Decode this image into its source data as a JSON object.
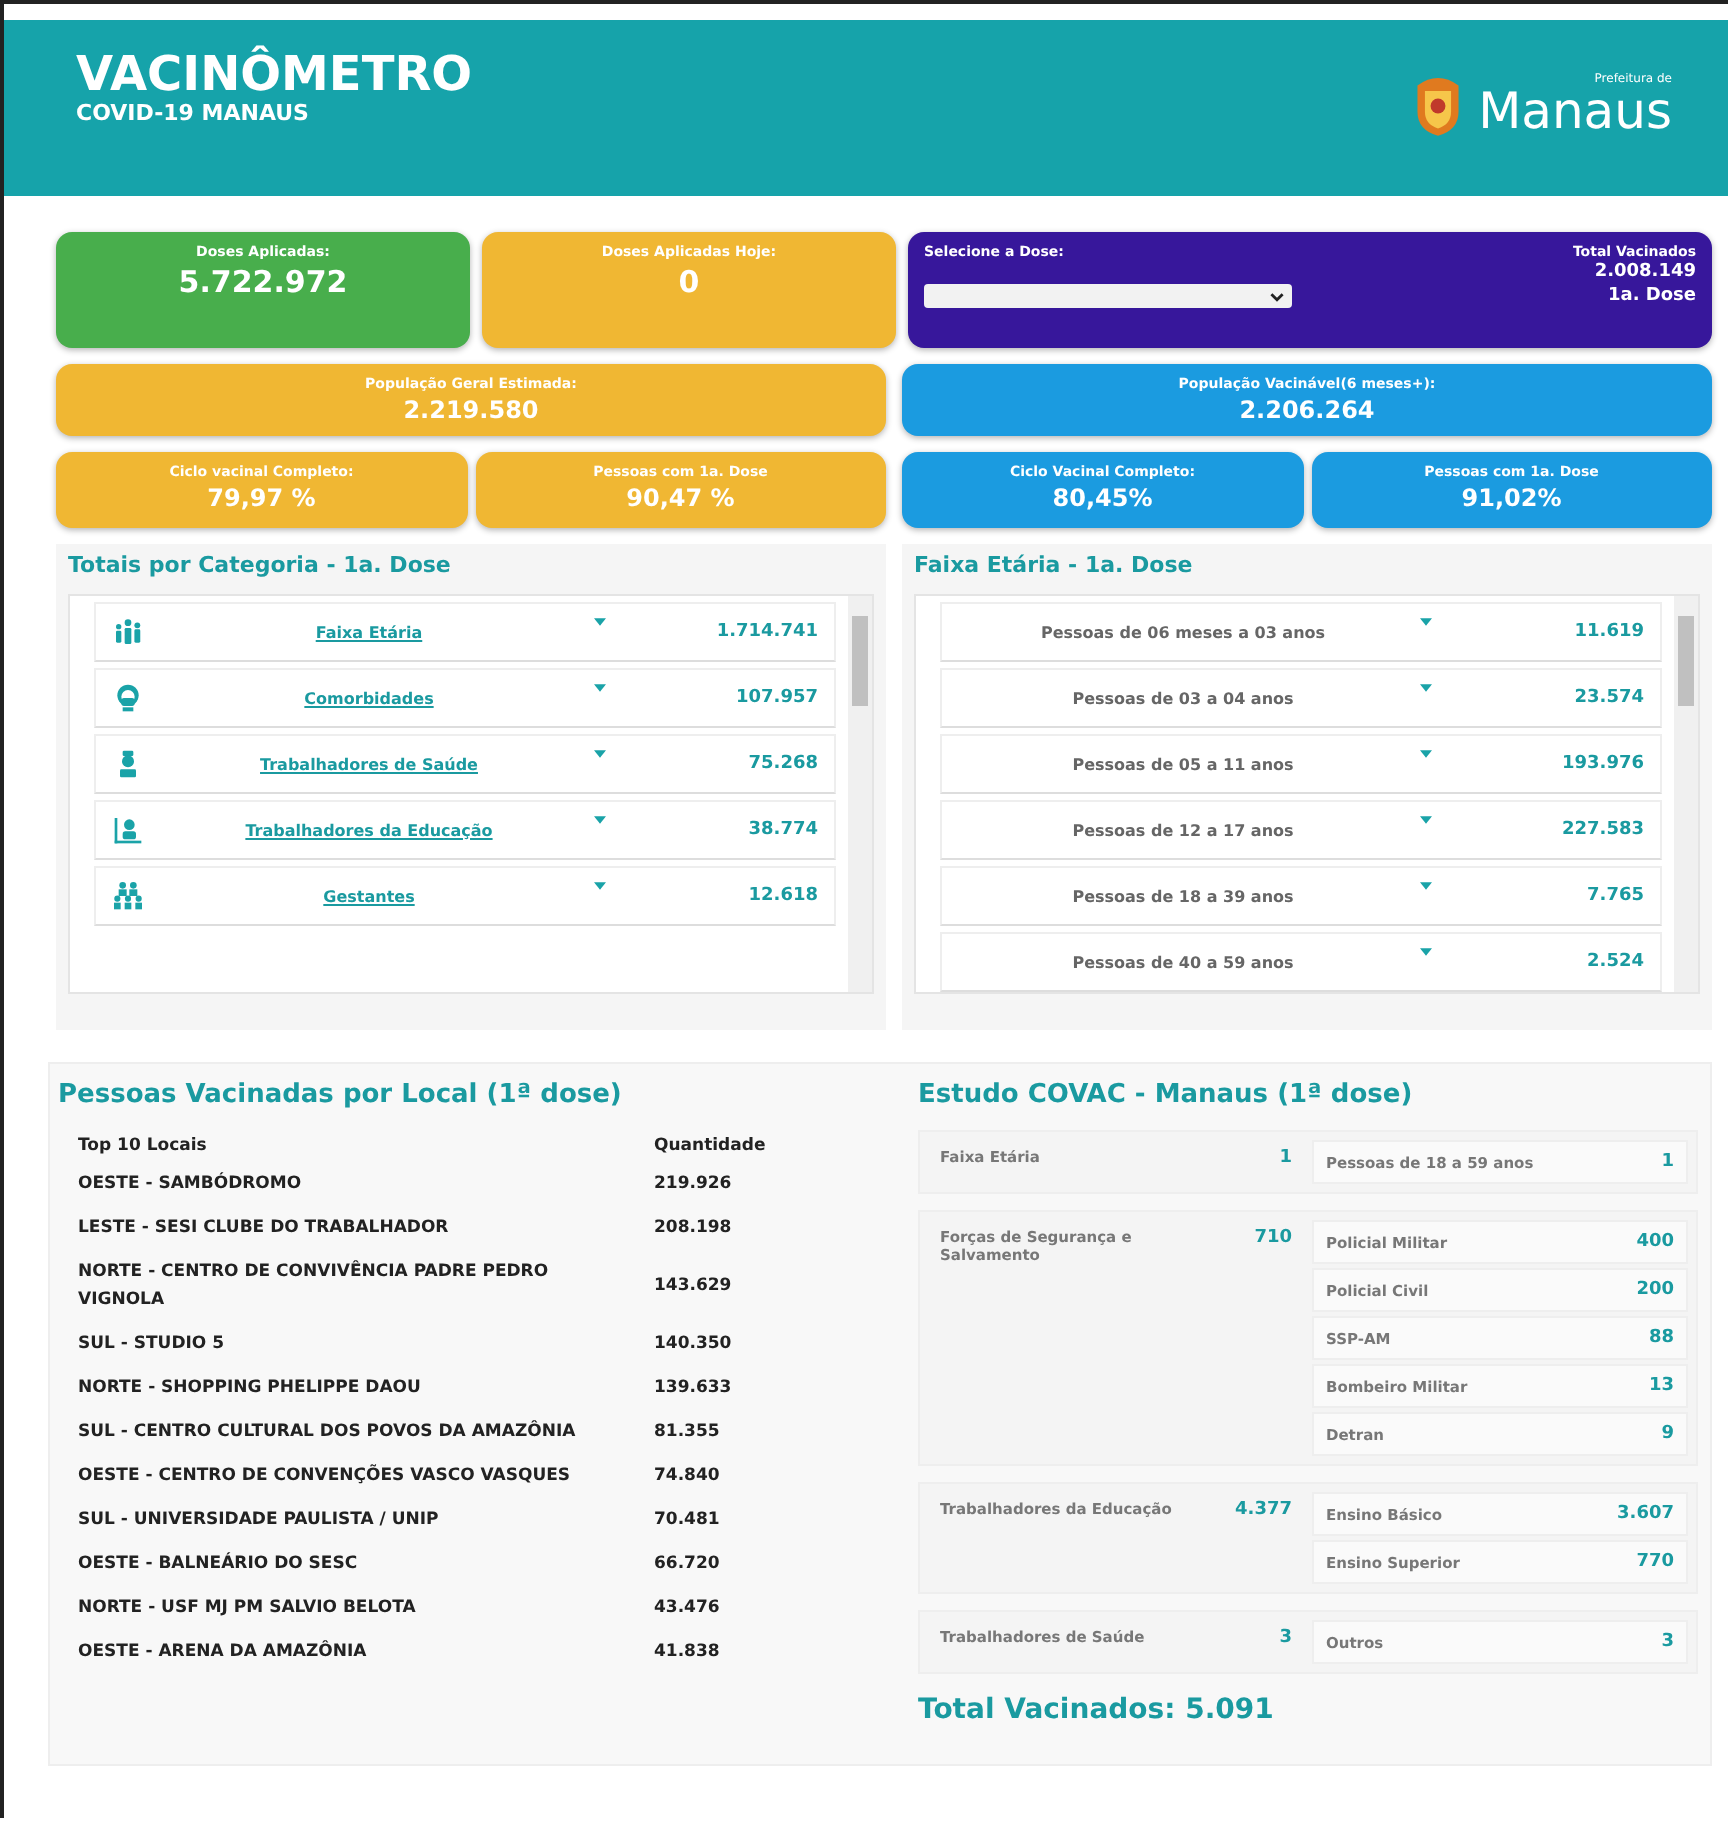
{
  "header": {
    "title": "VACINÔMETRO",
    "subtitle": "COVID-19 MANAUS",
    "logo_small": "Prefeitura de",
    "logo_name": "Manaus"
  },
  "doses_aplicadas": {
    "label": "Doses Aplicadas:",
    "value": "5.722.972"
  },
  "doses_hoje": {
    "label": "Doses Aplicadas Hoje:",
    "value": "0"
  },
  "dose_selector": {
    "label": "Selecione a Dose:",
    "total_label": "Total Vacinados",
    "total_value": "2.008.149",
    "dose": "1a. Dose"
  },
  "populacao_geral": {
    "label": "População Geral Estimada:",
    "value": "2.219.580"
  },
  "populacao_vacinavel": {
    "label": "População Vacinável(6 meses+):",
    "value": "2.206.264"
  },
  "geral_stats": [
    {
      "label": "Ciclo vacinal Completo:",
      "value": "79,97 %"
    },
    {
      "label": "Pessoas com 1a. Dose",
      "value": "90,47 %"
    }
  ],
  "vacinavel_stats": [
    {
      "label": "Ciclo Vacinal Completo:",
      "value": "80,45%"
    },
    {
      "label": "Pessoas com 1a. Dose",
      "value": "91,02%"
    }
  ],
  "categorias": {
    "title": "Totais por Categoria - 1a. Dose",
    "items": [
      {
        "label": "Faixa Etária",
        "value": "1.714.741"
      },
      {
        "label": "Comorbidades",
        "value": "107.957"
      },
      {
        "label": "Trabalhadores de Saúde",
        "value": "75.268"
      },
      {
        "label": "Trabalhadores da Educação",
        "value": "38.774"
      },
      {
        "label": "Gestantes",
        "value": "12.618"
      }
    ]
  },
  "faixa_etaria": {
    "title": "Faixa Etária - 1a. Dose",
    "items": [
      {
        "label": "Pessoas de 06 meses a 03 anos",
        "value": "11.619"
      },
      {
        "label": "Pessoas de 03 a 04 anos",
        "value": "23.574"
      },
      {
        "label": "Pessoas de 05 a 11 anos",
        "value": "193.976"
      },
      {
        "label": "Pessoas de 12 a 17 anos",
        "value": "227.583"
      },
      {
        "label": "Pessoas de 18 a 39 anos",
        "value": "7.765"
      },
      {
        "label": "Pessoas de 40 a 59 anos",
        "value": "2.524"
      }
    ]
  },
  "locais": {
    "title": "Pessoas Vacinadas por Local (1ª dose)",
    "columns": [
      "Top 10 Locais",
      "Quantidade"
    ],
    "rows": [
      {
        "local": "OESTE - SAMBÓDROMO",
        "quantidade": "219.926"
      },
      {
        "local": "LESTE - SESI CLUBE DO TRABALHADOR",
        "quantidade": "208.198"
      },
      {
        "local": "NORTE - CENTRO DE CONVIVÊNCIA PADRE PEDRO VIGNOLA",
        "quantidade": "143.629"
      },
      {
        "local": "SUL - STUDIO 5",
        "quantidade": "140.350"
      },
      {
        "local": "NORTE - SHOPPING PHELIPPE DAOU",
        "quantidade": "139.633"
      },
      {
        "local": "SUL - CENTRO CULTURAL DOS POVOS DA AMAZÔNIA",
        "quantidade": "81.355"
      },
      {
        "local": "OESTE - CENTRO DE CONVENÇÕES VASCO VASQUES",
        "quantidade": "74.840"
      },
      {
        "local": "SUL - UNIVERSIDADE PAULISTA / UNIP",
        "quantidade": "70.481"
      },
      {
        "local": "OESTE - BALNEÁRIO DO SESC",
        "quantidade": "66.720"
      },
      {
        "local": "NORTE - USF MJ PM SALVIO BELOTA",
        "quantidade": "43.476"
      },
      {
        "local": "OESTE - ARENA DA AMAZÔNIA",
        "quantidade": "41.838"
      }
    ]
  },
  "covac": {
    "title": "Estudo COVAC - Manaus (1ª dose)",
    "groups": [
      {
        "label": "Faixa Etária",
        "value": "1",
        "children": [
          {
            "label": "Pessoas de 18 a 59 anos",
            "value": "1"
          }
        ]
      },
      {
        "label": "Forças de Segurança e Salvamento",
        "value": "710",
        "children": [
          {
            "label": "Policial Militar",
            "value": "400"
          },
          {
            "label": "Policial Civil",
            "value": "200"
          },
          {
            "label": "SSP-AM",
            "value": "88"
          },
          {
            "label": "Bombeiro Militar",
            "value": "13"
          },
          {
            "label": "Detran",
            "value": "9"
          }
        ]
      },
      {
        "label": "Trabalhadores da Educação",
        "value": "4.377",
        "children": [
          {
            "label": "Ensino Básico",
            "value": "3.607"
          },
          {
            "label": "Ensino Superior",
            "value": "770"
          }
        ]
      },
      {
        "label": "Trabalhadores de Saúde",
        "value": "3",
        "children": [
          {
            "label": "Outros",
            "value": "3"
          }
        ]
      }
    ],
    "total": "Total Vacinados: 5.091"
  }
}
